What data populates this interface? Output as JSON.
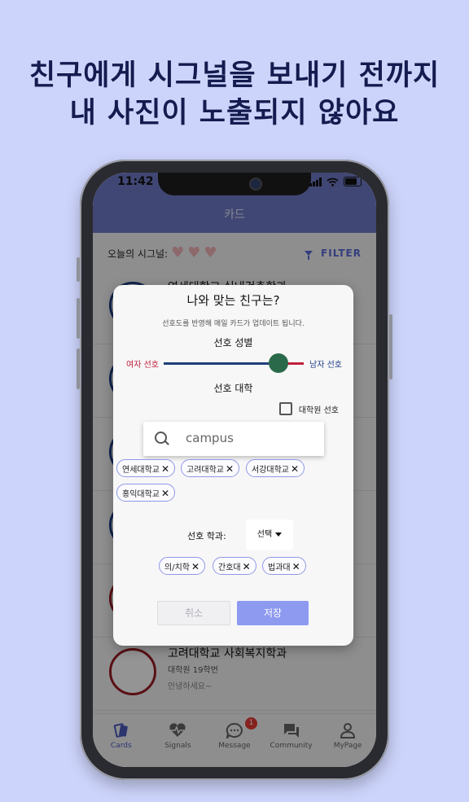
{
  "headline": {
    "line1": "친구에게 시그널을 보내기 전까지",
    "line2": "내 사진이 노출되지 않아요"
  },
  "status": {
    "time": "11:42"
  },
  "appbar": {
    "title": "카드"
  },
  "content": {
    "signal_label": "오늘의 시그널:",
    "filter_label": "FILTER",
    "cards": [
      {
        "title": "연세대학교 실내건축학과",
        "subtitle": "",
        "message": ""
      },
      {
        "title": "고려대학교 사회복지학과",
        "subtitle": "대학원 19학번",
        "message": "안녕하세요~"
      }
    ]
  },
  "dialog": {
    "title": "나와 맞는 친구는?",
    "subtitle": "선호도를 반영해 매일 카드가 업데이트 됩니다.",
    "gender_label": "선호 성별",
    "slider_left": "여자 선호",
    "slider_right": "남자 선호",
    "slider_value": 0.8,
    "univ_label": "선호 대학",
    "grad_label": "대학원 선호",
    "search": {
      "value": "campus"
    },
    "univ_chips": [
      "연세대학교",
      "고려대학교",
      "서강대학교",
      "홍익대학교"
    ],
    "dept_label": "선호 학과:",
    "select_value": "선택",
    "dept_chips": [
      "의/치학",
      "간호대",
      "법과대"
    ],
    "cancel_label": "취소",
    "save_label": "저장"
  },
  "tabs": [
    {
      "label": "Cards",
      "icon": "cards-icon"
    },
    {
      "label": "Signals",
      "icon": "heart-pulse-icon"
    },
    {
      "label": "Message",
      "icon": "chat-icon",
      "badge": "1"
    },
    {
      "label": "Community",
      "icon": "forum-icon"
    },
    {
      "label": "MyPage",
      "icon": "person-icon"
    }
  ],
  "colors": {
    "accent": "#717bc8",
    "save": "#8e9af0",
    "female": "#c0203a",
    "male": "#1e3a8a",
    "headline": "#141c4f"
  }
}
